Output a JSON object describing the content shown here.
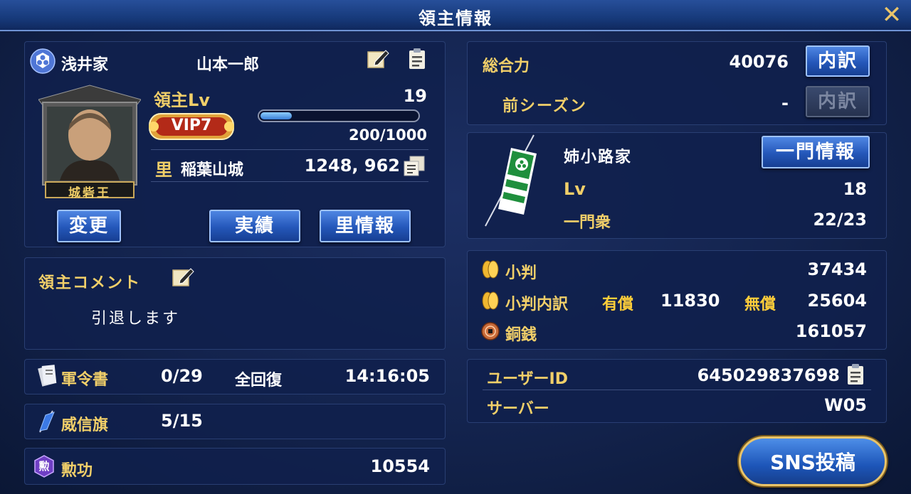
{
  "window": {
    "title": "領主情報",
    "close_label": "✕"
  },
  "profile": {
    "clan_name": "浅井家",
    "lord_name": "山本一郎",
    "level_label": "領主Lv",
    "level_value": "19",
    "vip_label": "VIP7",
    "exp_text": "200/1000",
    "exp_fraction": 0.2,
    "village_prefix": "里",
    "castle_name": "稲葉山城",
    "coordinates": "1248, 962",
    "portrait_title": "城砦王",
    "change_button": "変更",
    "achievements_button": "実績",
    "village_info_button": "里情報"
  },
  "comment": {
    "label": "領主コメント",
    "text": "引退します"
  },
  "orders": {
    "label": "軍令書",
    "value": "0/29",
    "recover_label": "全回復",
    "recover_time": "14:16:05"
  },
  "flags": {
    "label": "威信旗",
    "value": "5/15"
  },
  "merit": {
    "label": "勲功",
    "value": "10554",
    "icon_char": "勲"
  },
  "power": {
    "total_label": "総合力",
    "total_value": "40076",
    "breakdown_button": "内訳",
    "prev_label": "前シーズン",
    "prev_value": "-",
    "prev_button": "内訳"
  },
  "family": {
    "name": "姉小路家",
    "info_button": "一門情報",
    "lv_label": "Lv",
    "lv_value": "18",
    "members_label": "一門衆",
    "members_value": "22/23"
  },
  "currency": {
    "koban_label": "小判",
    "koban_value": "37434",
    "koban_detail_label": "小判内訳",
    "paid_label": "有償",
    "paid_value": "11830",
    "free_label": "無償",
    "free_value": "25604",
    "copper_label": "銅銭",
    "copper_value": "161057"
  },
  "account": {
    "user_id_label": "ユーザーID",
    "user_id_value": "645029837698",
    "server_label": "サーバー",
    "server_value": "W05"
  },
  "sns_button": "SNS投稿",
  "colors": {
    "accent_gold": "#f1cf69",
    "button_blue": "#2457b9",
    "panel": "#10204c"
  }
}
